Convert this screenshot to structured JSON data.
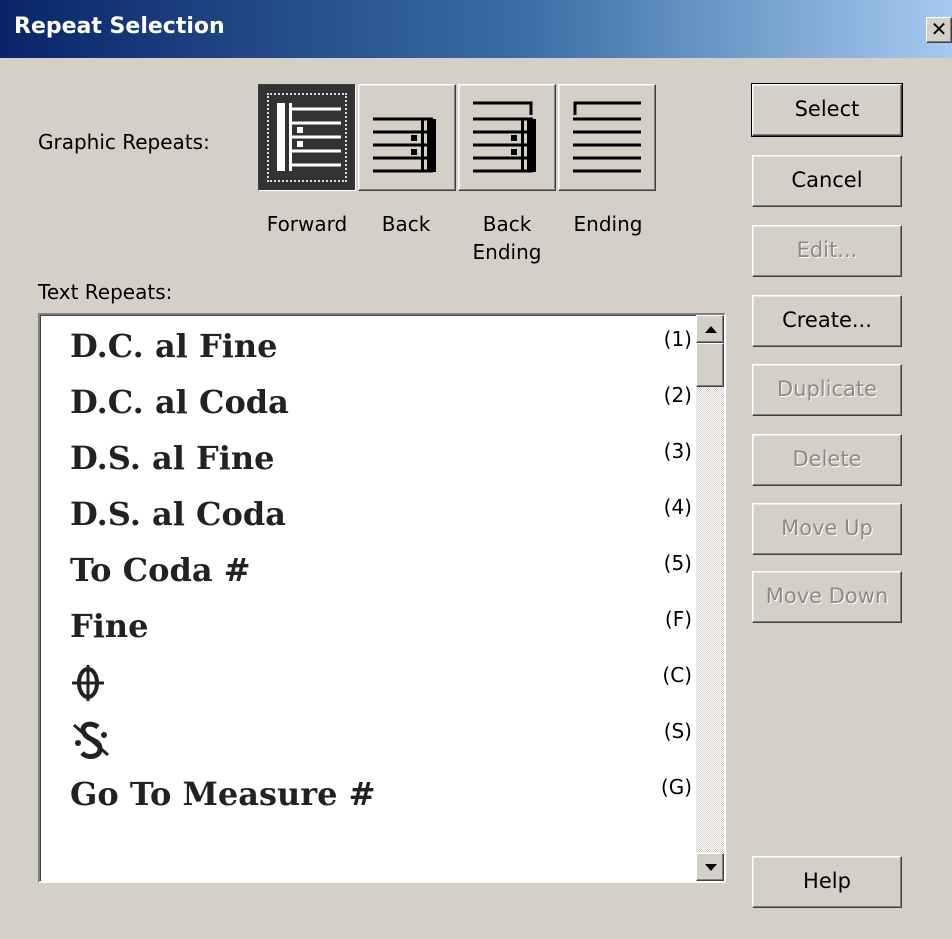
{
  "window": {
    "title": "Repeat Selection",
    "close_label": "✕"
  },
  "graphic_repeats": {
    "label": "Graphic Repeats:",
    "buttons": [
      {
        "caption": "Forward",
        "selected": true
      },
      {
        "caption": "Back",
        "selected": false
      },
      {
        "caption": "Back Ending",
        "selected": false
      },
      {
        "caption": "Ending",
        "selected": false
      }
    ],
    "captions": {
      "forward": "Forward",
      "back": "Back",
      "back_ending_1": "Back",
      "back_ending_2": "Ending",
      "ending": "Ending"
    }
  },
  "text_repeats": {
    "label": "Text Repeats:",
    "items": [
      {
        "name": "D.C. al Fine",
        "key": "(1)"
      },
      {
        "name": "D.C. al Coda",
        "key": "(2)"
      },
      {
        "name": "D.S. al Fine",
        "key": "(3)"
      },
      {
        "name": "D.S. al Coda",
        "key": "(4)"
      },
      {
        "name": "To Coda #",
        "key": "(5)"
      },
      {
        "name": "Fine",
        "key": "(F)"
      },
      {
        "name": "coda symbol",
        "key": "(C)"
      },
      {
        "name": "segno symbol",
        "key": "(S)"
      },
      {
        "name": "Go To Measure #",
        "key": "(G)"
      }
    ]
  },
  "buttons": {
    "select": {
      "label": "Select",
      "enabled": true
    },
    "cancel": {
      "label": "Cancel",
      "enabled": true
    },
    "edit": {
      "label": "Edit...",
      "enabled": false
    },
    "create": {
      "label": "Create...",
      "enabled": true
    },
    "duplicate": {
      "label": "Duplicate",
      "enabled": false
    },
    "delete": {
      "label": "Delete",
      "enabled": false
    },
    "move_up": {
      "label": "Move Up",
      "enabled": false
    },
    "move_down": {
      "label": "Move Down",
      "enabled": false
    },
    "help": {
      "label": "Help",
      "enabled": true
    }
  }
}
